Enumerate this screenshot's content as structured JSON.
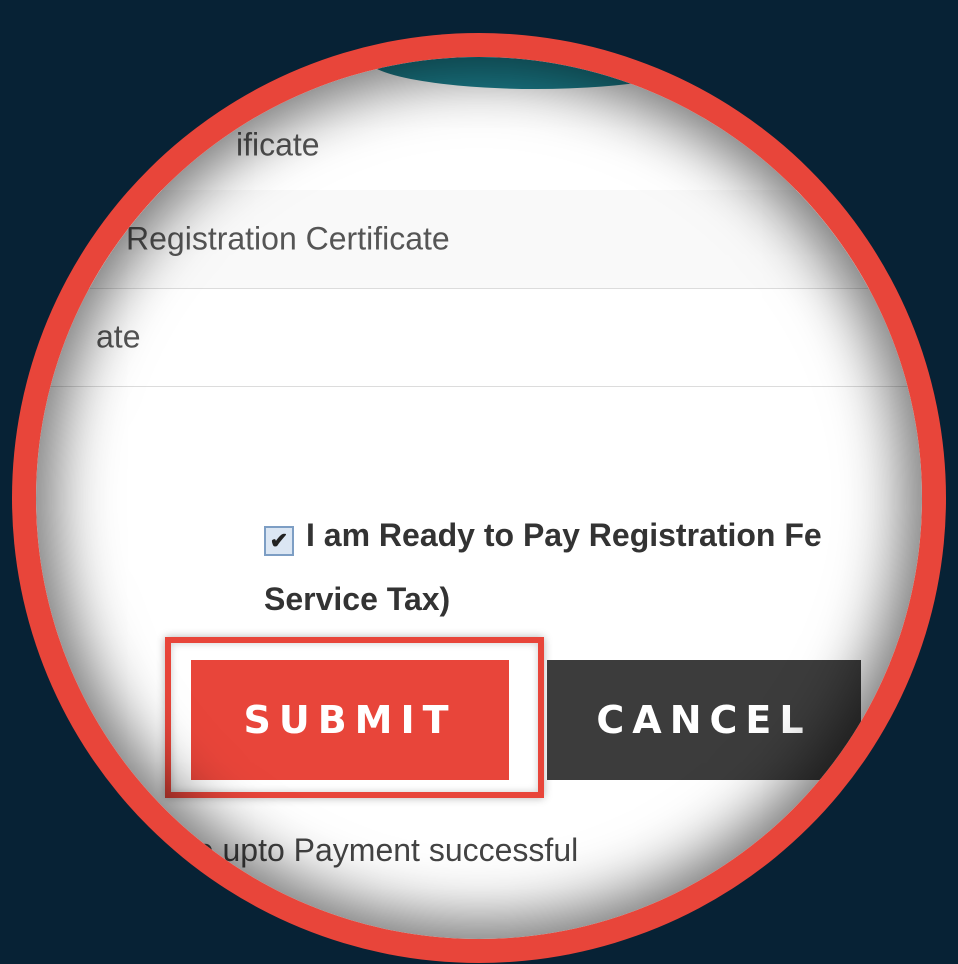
{
  "rows": [
    {
      "label": "ificate"
    },
    {
      "label": "Registration Certificate"
    },
    {
      "label": "ate"
    }
  ],
  "consent": {
    "checked": true,
    "line1": "I am Ready to Pay Registration Fe",
    "line2": "Service Tax)"
  },
  "buttons": {
    "submit": "SUBMIT",
    "cancel": "CANCEL"
  },
  "note": "late upto Payment successful",
  "colors": {
    "accent": "#e8453a",
    "background": "#072235",
    "cancel": "#3c3c3c",
    "top_bar": "#1b7e8c"
  }
}
